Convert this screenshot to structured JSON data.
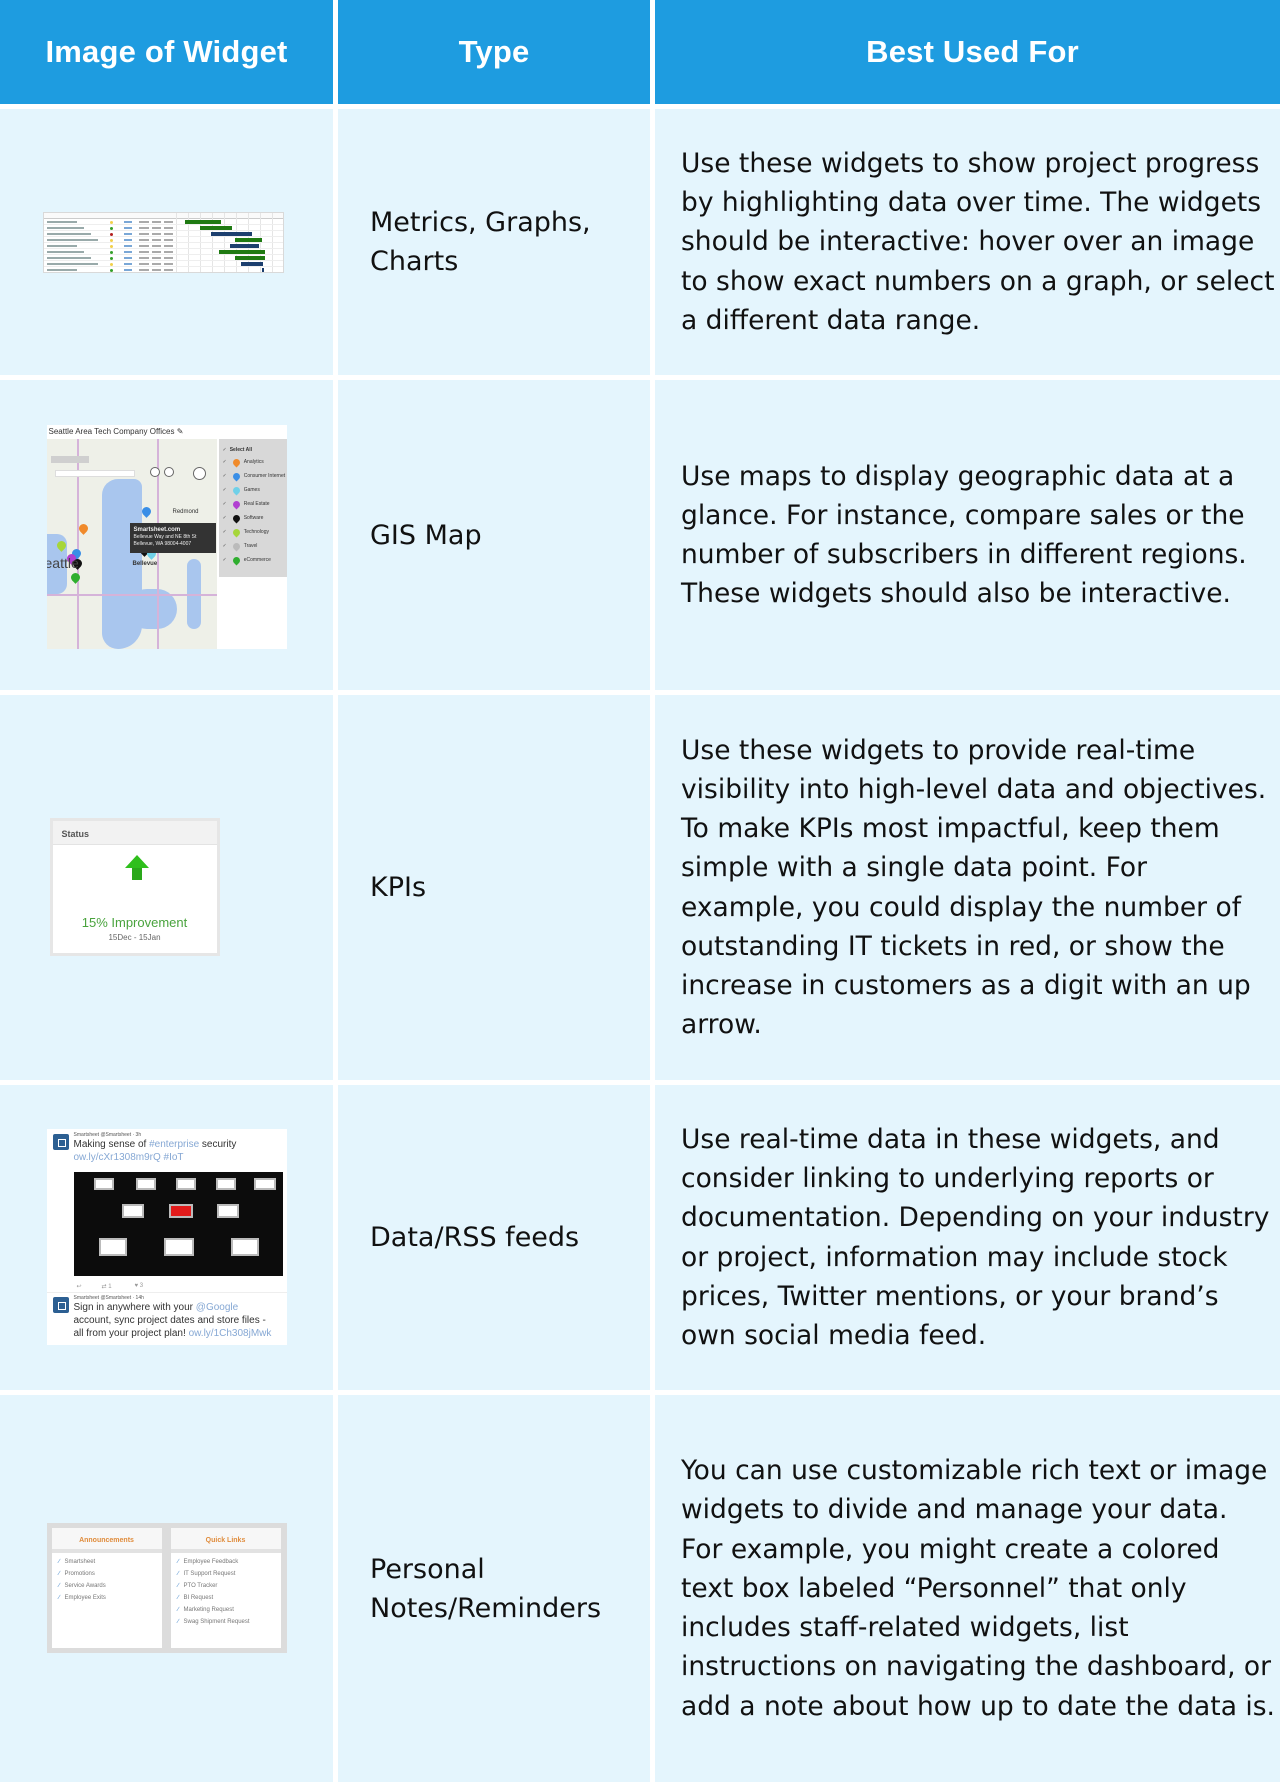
{
  "header": {
    "col_image": "Image of Widget",
    "col_type": "Type",
    "col_best": "Best Used For"
  },
  "colors": {
    "header_bg": "#1e9ce0",
    "cell_bg": "#e4f5fd",
    "text": "#111111"
  },
  "rows": [
    {
      "type": "Metrics, Graphs, Charts",
      "best_used_for": "Use these widgets to show project progress by highlighting data over time. The widgets should be interactive: hover over an image to show exact numbers on a graph, or select a different data range.",
      "thumbnail": {
        "kind": "gantt-chart",
        "bars": [
          {
            "start": 0.08,
            "end": 0.42,
            "color": "#1f7a12",
            "status": "#f1d04b"
          },
          {
            "start": 0.22,
            "end": 0.52,
            "color": "#1f7a12",
            "status": "#35a02a"
          },
          {
            "start": 0.32,
            "end": 0.7,
            "color": "#1c3f6e",
            "status": "#b32020"
          },
          {
            "start": 0.55,
            "end": 0.8,
            "color": "#1f7a12",
            "status": "#f1d04b"
          },
          {
            "start": 0.5,
            "end": 0.77,
            "color": "#1c3f6e",
            "status": "#f1d04b"
          },
          {
            "start": 0.4,
            "end": 0.82,
            "color": "#1f7a12",
            "status": "#35a02a"
          },
          {
            "start": 0.55,
            "end": 0.82,
            "color": "#1f7a12",
            "status": "#35a02a"
          },
          {
            "start": 0.6,
            "end": 0.81,
            "color": "#1c3f6e",
            "status": "#f1d04b"
          },
          {
            "start": 0.8,
            "end": 0.81,
            "color": "#1c3f6e",
            "status": "#35a02a"
          }
        ]
      }
    },
    {
      "type": "GIS Map",
      "best_used_for": "Use maps to display geographic data at a glance. For instance, compare sales or the number of subscribers in different regions. These widgets should also be interactive.",
      "thumbnail": {
        "kind": "map",
        "title": "Seattle Area Tech Company Offices",
        "tooltip_title": "Smartsheet.com",
        "tooltip_line1": "Bellevue Way and NE 8th St",
        "tooltip_line2": "Bellevue, WA 98004-4007",
        "city_large": "eattle",
        "city_bellevue": "Bellevue",
        "city_redmond": "Redmond",
        "legend": [
          {
            "label": "Select All",
            "color": ""
          },
          {
            "label": "Analytics",
            "color": "#f08a2a"
          },
          {
            "label": "Consumer Internet",
            "color": "#3a8ee6"
          },
          {
            "label": "Games",
            "color": "#6fd0e8"
          },
          {
            "label": "Real Estate",
            "color": "#b13fd1"
          },
          {
            "label": "Software",
            "color": "#111111"
          },
          {
            "label": "Technology",
            "color": "#a6d63a"
          },
          {
            "label": "Travel",
            "color": "#bbbbbb"
          },
          {
            "label": "eCommerce",
            "color": "#2fae2f"
          }
        ]
      }
    },
    {
      "type": "KPIs",
      "best_used_for": "Use these widgets to provide real-time visibility into high-level data and objectives. To make KPIs most impactful, keep them simple with a single data point. For example, you could display the number of outstanding IT tickets in red, or show the increase in customers as a digit with an up arrow.",
      "thumbnail": {
        "kind": "kpi",
        "header": "Status",
        "value": "15% Improvement",
        "date_range": "15Dec - 15Jan",
        "arrow_color": "#2fbf1c"
      }
    },
    {
      "type": "Data/RSS feeds",
      "best_used_for": "Use real-time data in these widgets, and consider linking to underlying reports or documentation. Depending on your industry or project, information may include stock prices, Twitter mentions, or your brand’s own social media feed.",
      "thumbnail": {
        "kind": "feed",
        "posts": [
          {
            "author": "Smartsheet @Smartsheet · 3h",
            "line1": "Making sense of ",
            "hashtag": "#enterprise",
            "line1_end": " security",
            "line2": "ow.ly/cXr1308m9rQ #IoT"
          },
          {
            "author": "Smartsheet @Smartsheet · 14h",
            "line1": "Sign in anywhere with your ",
            "mention": "@Google",
            "line2": "account, sync project dates and store files -",
            "line3": "all from your project plan! ",
            "link": "ow.ly/1Ch308jMwk"
          }
        ],
        "retweets": "1",
        "likes": "3"
      }
    },
    {
      "type": "Personal Notes/Reminders",
      "best_used_for": "You can use customizable rich text or image widgets to divide and manage your data. For example, you might create a colored text box labeled “Personnel” that only includes staff-related widgets, list instructions on navigating the dashboard, or add a note about how up to date the data is.",
      "thumbnail": {
        "kind": "notes",
        "panels": [
          {
            "title": "Announcements",
            "items": [
              "Smartsheet",
              "Promotions",
              "Service Awards",
              "Employee Exits"
            ]
          },
          {
            "title": "Quick Links",
            "items": [
              "Employee Feedback",
              "IT Support Request",
              "PTO Tracker",
              "BI Request",
              "Marketing Request",
              "Swag Shipment Request"
            ]
          }
        ]
      }
    }
  ]
}
